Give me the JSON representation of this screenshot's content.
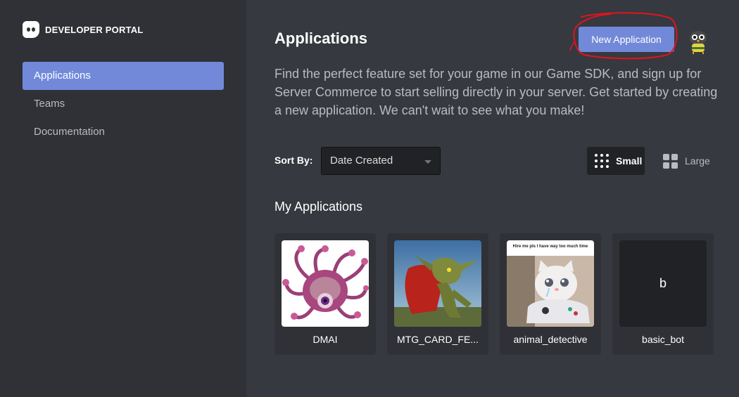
{
  "brand": {
    "title": "DEVELOPER PORTAL",
    "icon": "discord-logo-icon"
  },
  "sidebar": {
    "items": [
      {
        "label": "Applications",
        "active": true
      },
      {
        "label": "Teams",
        "active": false
      },
      {
        "label": "Documentation",
        "active": false
      }
    ]
  },
  "header": {
    "title": "Applications",
    "new_app_label": "New Application",
    "description": "Find the perfect feature set for your game in our Game SDK, and sign up for Server Commerce to start selling directly in your server. Get started by creating a new application. We can't wait to see what you make!"
  },
  "controls": {
    "sort_label": "Sort By:",
    "sort_value": "Date Created",
    "size_small_label": "Small",
    "size_large_label": "Large",
    "selected_size": "Small"
  },
  "apps_section": {
    "title": "My Applications",
    "apps": [
      {
        "name": "DMAI",
        "icon": "beholder-image"
      },
      {
        "name": "MTG_CARD_FE...",
        "icon": "goblin-image"
      },
      {
        "name": "animal_detective",
        "icon": "crying-cat-gamer-image",
        "caption": "Hire me pls I have way too much time"
      },
      {
        "name": "basic_bot",
        "initial": "b"
      }
    ]
  },
  "colors": {
    "accent": "#7289da",
    "sidebar_bg": "#2f3136",
    "main_bg": "#36393f",
    "annotation_red": "#e0141e"
  }
}
